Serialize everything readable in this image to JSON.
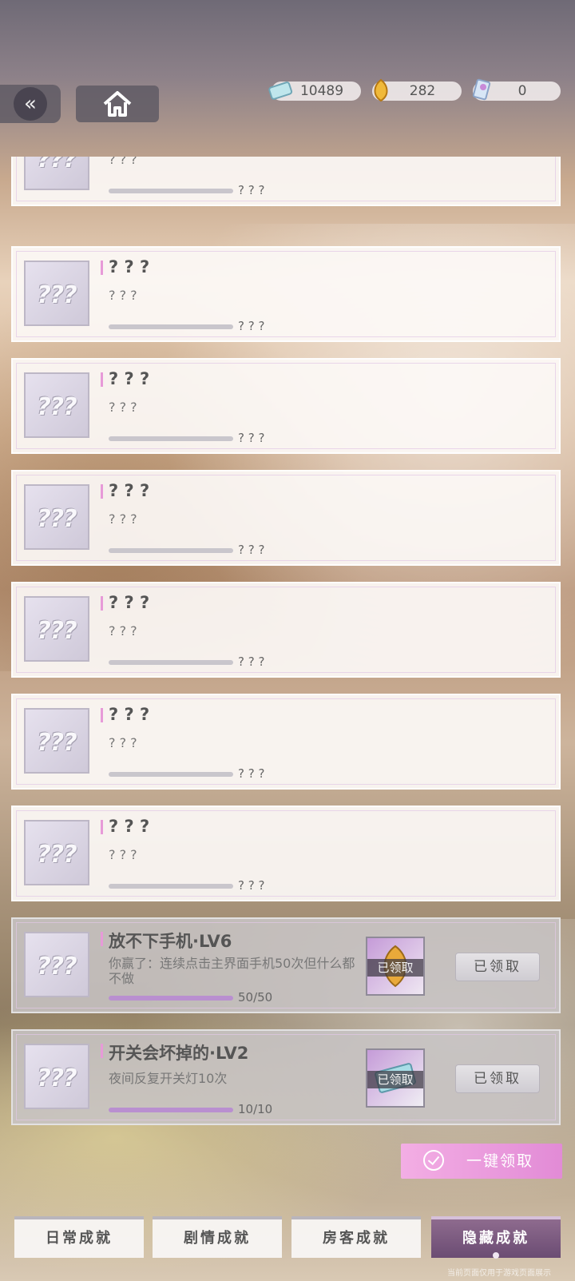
{
  "header": {
    "back_icon": "double-chevron-left-icon",
    "home_icon": "home-icon",
    "currencies": [
      {
        "icon": "ticket-icon",
        "value": "10489"
      },
      {
        "icon": "gem-icon",
        "value": "282"
      },
      {
        "icon": "card-icon",
        "value": "0"
      }
    ]
  },
  "achievements": [
    {
      "title": "? ? ?",
      "desc": "? ? ?",
      "progress_text": "? ? ?",
      "progress": 0,
      "locked": true
    },
    {
      "title": "? ? ?",
      "desc": "? ? ?",
      "progress_text": "? ? ?",
      "progress": 0,
      "locked": true
    },
    {
      "title": "? ? ?",
      "desc": "? ? ?",
      "progress_text": "? ? ?",
      "progress": 0,
      "locked": true
    },
    {
      "title": "? ? ?",
      "desc": "? ? ?",
      "progress_text": "? ? ?",
      "progress": 0,
      "locked": true
    },
    {
      "title": "? ? ?",
      "desc": "? ? ?",
      "progress_text": "? ? ?",
      "progress": 0,
      "locked": true
    },
    {
      "title": "? ? ?",
      "desc": "? ? ?",
      "progress_text": "? ? ?",
      "progress": 0,
      "locked": true
    },
    {
      "title": "? ? ?",
      "desc": "? ? ?",
      "progress_text": "? ? ?",
      "progress": 0,
      "locked": true
    },
    {
      "title": "放不下手机·LV6",
      "desc": "你赢了：连续点击主界面手机50次但什么都不做",
      "progress_text": "50/50",
      "progress": 1,
      "locked": false,
      "reward_label": "已领取",
      "status_label": "已领取"
    },
    {
      "title": "开关会坏掉的·LV2",
      "desc": "夜间反复开关灯10次",
      "progress_text": "10/10",
      "progress": 1,
      "locked": false,
      "reward_label": "已领取",
      "status_label": "已领取"
    }
  ],
  "placeholder_thumb": "???",
  "claim_all_label": "一键领取",
  "tabs": [
    {
      "label": "日常成就",
      "active": false
    },
    {
      "label": "剧情成就",
      "active": false
    },
    {
      "label": "房客成就",
      "active": false
    },
    {
      "label": "隐藏成就",
      "active": true
    }
  ],
  "footer_note": "当前页面仅用于游戏页面展示",
  "colors": {
    "accent": "#e79ad8",
    "active_tab": "#6b4c73",
    "claim_all": "#e28bd6"
  }
}
